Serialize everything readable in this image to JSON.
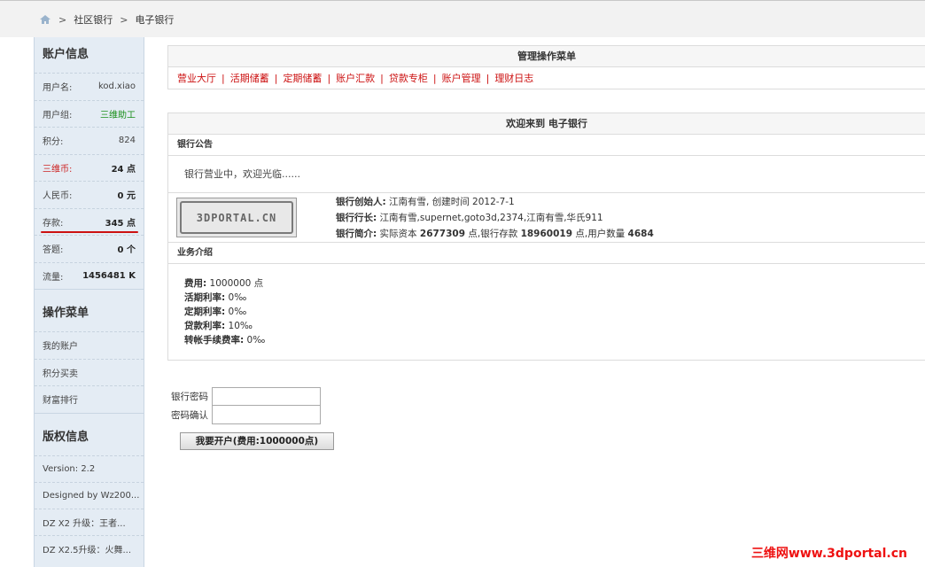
{
  "breadcrumb": {
    "sep": ">",
    "items": [
      "社区银行",
      "电子银行"
    ]
  },
  "sidebar": {
    "account": {
      "title": "账户信息",
      "rows": [
        {
          "label": "用户名:",
          "value": "kod.xiao"
        },
        {
          "label": "用户组:",
          "value": "三维助工"
        },
        {
          "label": "积分:",
          "value": "824"
        },
        {
          "label": "三维币:",
          "value": "24 点"
        },
        {
          "label": "人民币:",
          "value": "0 元"
        },
        {
          "label": "存款:",
          "value": "345 点"
        },
        {
          "label": "答题:",
          "value": "0 个"
        },
        {
          "label": "流量:",
          "value": "1456481 K"
        }
      ]
    },
    "ops": {
      "title": "操作菜单",
      "items": [
        "我的账户",
        "积分买卖",
        "财富排行"
      ]
    },
    "copyright": {
      "title": "版权信息",
      "items": [
        "Version: 2.2",
        "Designed by Wz200...",
        "DZ X2 升级：王者...",
        "DZ X2.5升级：火舞..."
      ]
    }
  },
  "menu_box": {
    "title": "管理操作菜单",
    "items": [
      "营业大厅",
      "活期储蓄",
      "定期储蓄",
      "账户汇款",
      "贷款专柜",
      "账户管理",
      "理财日志"
    ],
    "sep": "|"
  },
  "welcome": {
    "title": "欢迎来到 电子银行",
    "notice_title": "银行公告",
    "notice": "银行营业中，欢迎光临......",
    "logo_text": "3DPORTAL.CN",
    "founder_label": "银行创始人:",
    "founder_value": " 江南有雪, 创建时间 2012-7-1",
    "president_label": "银行行长:",
    "president_value": " 江南有雪,supernet,goto3d,2374,江南有雪,华氏911",
    "intro_label": "银行简介:",
    "intro_pre": " 实际资本 ",
    "capital": "2677309",
    "intro_mid": " 点,银行存款 ",
    "deposits": "18960019",
    "intro_mid2": " 点,用户数量 ",
    "users": "4684",
    "business_title": "业务介绍",
    "rates": [
      {
        "label": "费用:",
        "value": " 1000000 点"
      },
      {
        "label": "活期利率:",
        "value": " 0‰"
      },
      {
        "label": "定期利率:",
        "value": " 0‰"
      },
      {
        "label": "贷款利率:",
        "value": " 10‰"
      },
      {
        "label": "转帐手续费率:",
        "value": " 0‰"
      }
    ]
  },
  "form": {
    "password_label": "银行密码",
    "confirm_label": "密码确认",
    "button": "我要开户(费用:1000000点)"
  },
  "watermark": "三维网www.3dportal.cn",
  "colors": {
    "link_red": "#cc1111",
    "sidebar_bg": "#e4ecf4",
    "green": "#1a8f1a"
  }
}
